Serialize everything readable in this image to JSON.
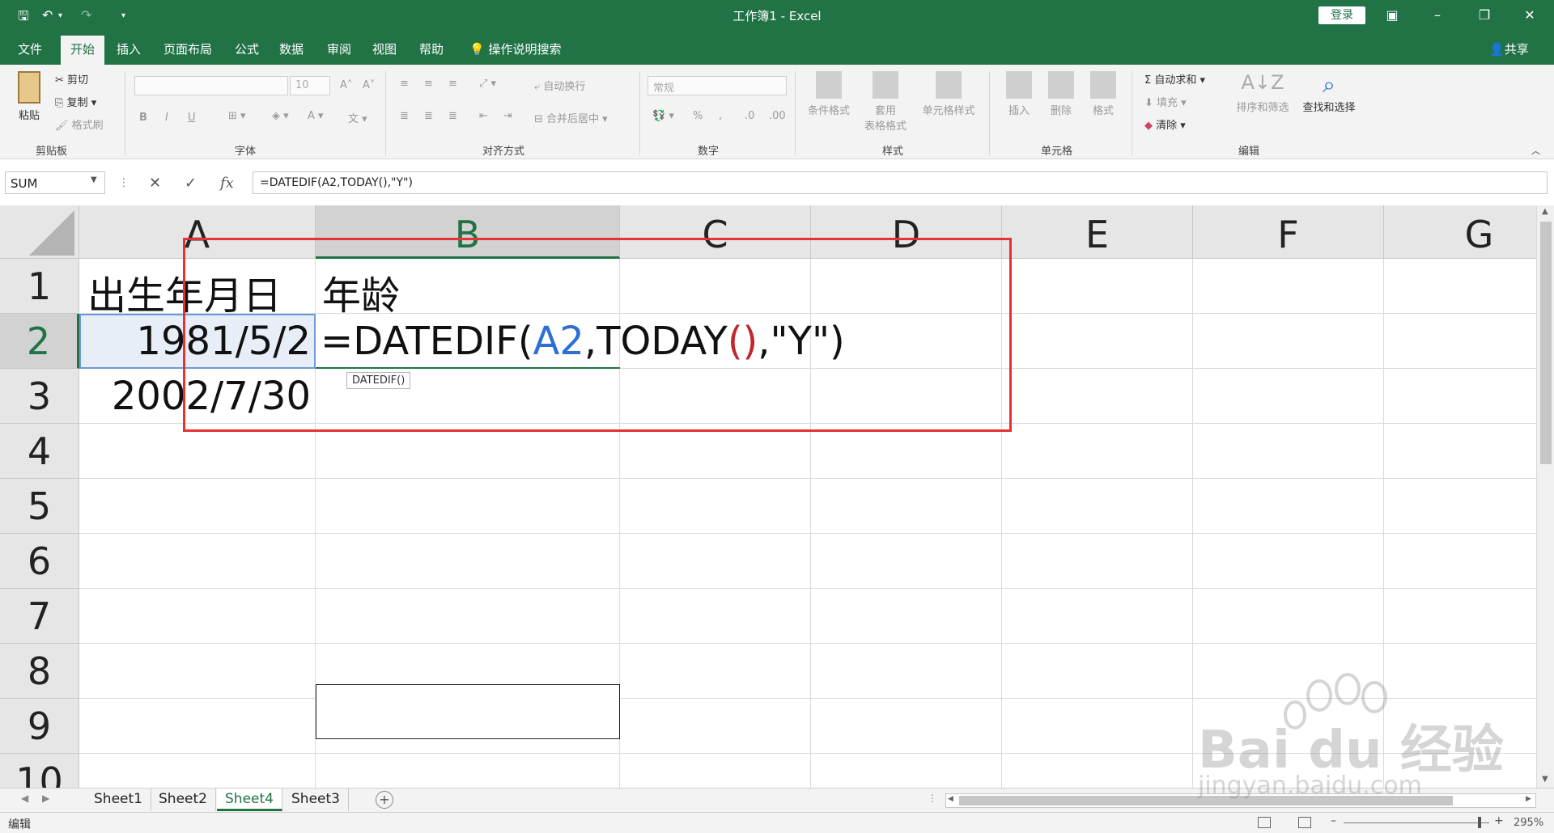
{
  "window": {
    "title": "工作簿1  -  Excel",
    "login_label": "登录"
  },
  "tabs": [
    "文件",
    "开始",
    "插入",
    "页面布局",
    "公式",
    "数据",
    "审阅",
    "视图",
    "帮助"
  ],
  "tell_me": "操作说明搜索",
  "share_label": "共享",
  "ribbon": {
    "clipboard": {
      "paste": "粘贴",
      "cut": "剪切",
      "copy": "复制",
      "format_painter": "格式刷",
      "label": "剪贴板"
    },
    "font": {
      "size": "10",
      "bold": "B",
      "italic": "I",
      "underline": "U",
      "label": "字体"
    },
    "alignment": {
      "wrap": "自动换行",
      "merge": "合并后居中",
      "label": "对齐方式"
    },
    "number": {
      "format": "常规",
      "percent": "%",
      "comma": ",",
      "label": "数字"
    },
    "styles": {
      "conditional": "条件格式",
      "table_line1": "套用",
      "table_line2": "表格格式",
      "cell_styles": "单元格样式",
      "label": "样式"
    },
    "cells": {
      "insert": "插入",
      "delete": "删除",
      "format": "格式",
      "label": "单元格"
    },
    "editing": {
      "autosum": "自动求和",
      "fill": "填充",
      "clear": "清除",
      "sort": "排序和筛选",
      "find": "查找和选择",
      "label": "编辑"
    }
  },
  "formula_bar": {
    "name_box": "SUM",
    "cancel": "✕",
    "enter": "✓",
    "fx": "fx",
    "formula": "=DATEDIF(A2,TODAY(),\"Y\")"
  },
  "columns": [
    "A",
    "B",
    "C",
    "D",
    "E",
    "F",
    "G"
  ],
  "rows": [
    "1",
    "2",
    "3",
    "4",
    "5",
    "6",
    "7",
    "8",
    "9",
    "10"
  ],
  "cells": {
    "A1": "出生年月日",
    "B1": "年龄",
    "A2": "1981/5/2",
    "A3": "2002/7/30",
    "B2_parts": {
      "p1": "=DATEDIF(",
      "ref": "A2",
      "p2": ",TODAY",
      "paren": "()",
      "p3": ",\"Y\")"
    }
  },
  "tooltip": "DATEDIF()",
  "sheets": [
    "Sheet1",
    "Sheet2",
    "Sheet4",
    "Sheet3"
  ],
  "active_sheet": "Sheet4",
  "status": {
    "mode": "编辑",
    "zoom": "295%"
  },
  "watermark": {
    "brand": "Bai du 经验",
    "url": "jingyan.baidu.com"
  },
  "colors": {
    "excel_green": "#217346",
    "highlight_red": "#e53333",
    "ref_blue": "#2e6fd3"
  }
}
